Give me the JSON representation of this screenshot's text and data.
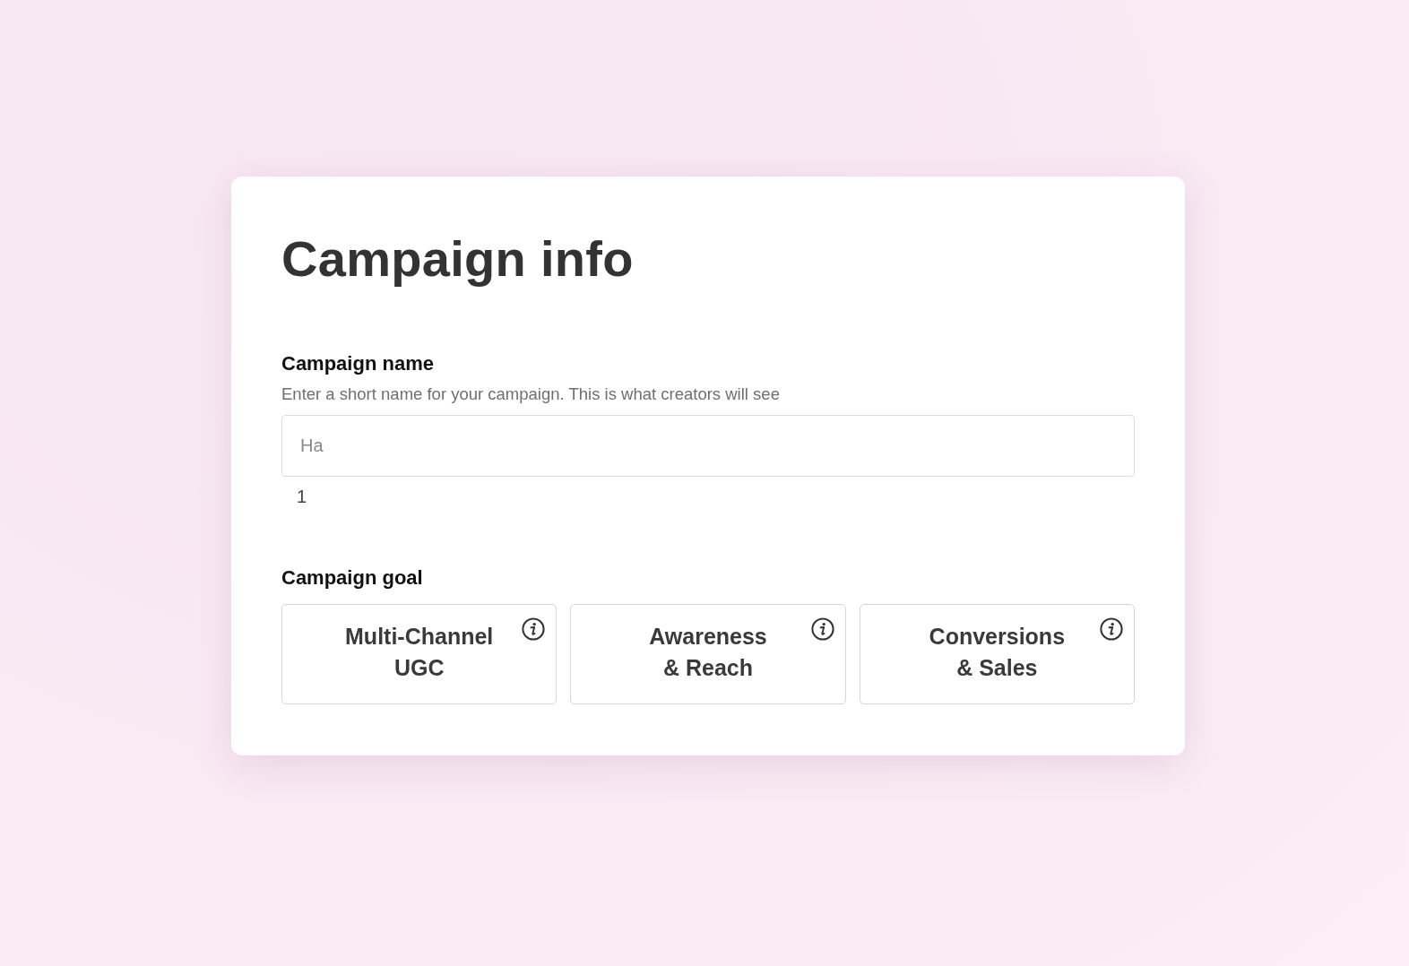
{
  "title": "Campaign info",
  "name_field": {
    "label": "Campaign name",
    "hint": "Enter a short name for your campaign. This is what creators will see",
    "placeholder": "Ha",
    "counter": "1"
  },
  "goal": {
    "label": "Campaign goal",
    "options": [
      {
        "lines": [
          "Multi-Channel",
          "UGC"
        ],
        "selected": false
      },
      {
        "lines": [
          "Awareness",
          "& Reach"
        ],
        "selected": false
      },
      {
        "lines": [
          "Conversions",
          "& Sales"
        ],
        "selected": false
      }
    ]
  }
}
